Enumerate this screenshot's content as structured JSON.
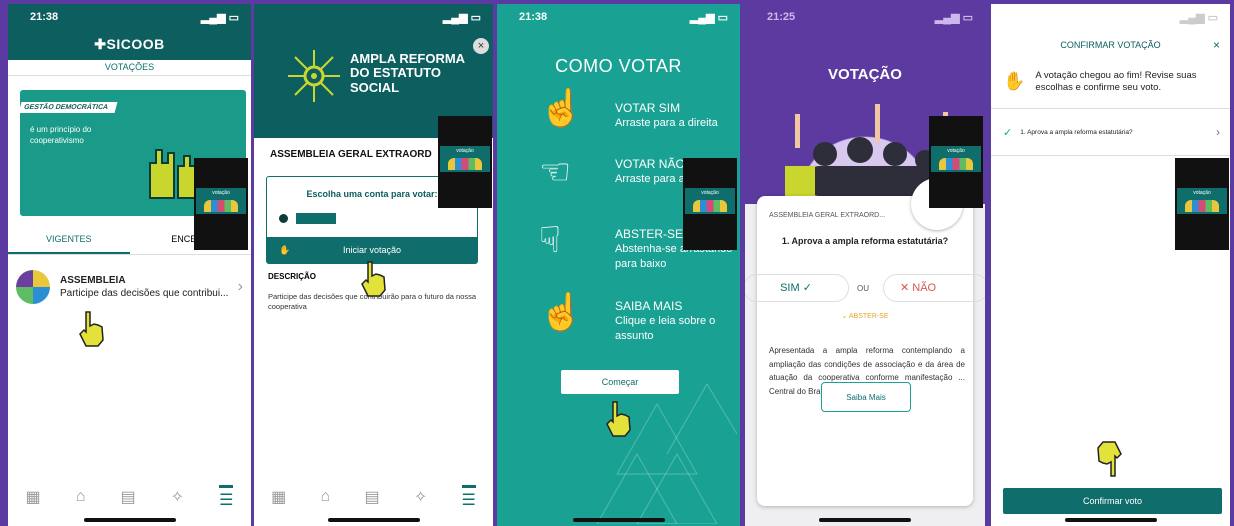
{
  "p1": {
    "time": "21:38",
    "brand": "SICOOB",
    "section": "VOTAÇÕES",
    "card_badge": "GESTÃO DEMOCRÁTICA",
    "card_text": "é um princípio do cooperativismo",
    "tabs": [
      "VIGENTES",
      "ENCERR"
    ],
    "item_title": "ASSEMBLEIA",
    "item_sub": "Participe das decisões que contribui..."
  },
  "p2": {
    "title": "AMPLA REFORMA DO ESTATUTO SOCIAL",
    "close": "×",
    "assembly": "ASSEMBLEIA GERAL EXTRAORD",
    "choose": "Escolha uma conta para votar:",
    "start": "Iniciar votação",
    "desc_label": "DESCRIÇÃO",
    "desc_text": "Participe das decisões que contribuirão para o futuro da nossa cooperativa"
  },
  "p3": {
    "time": "21:38",
    "title": "COMO VOTAR",
    "rows": [
      {
        "title": "VOTAR SIM",
        "text": "Arraste para a direita",
        "icon": "swipe-right-icon",
        "glyph": "☝"
      },
      {
        "title": "VOTAR NÃO",
        "text": "Arraste para a esquerda",
        "icon": "swipe-left-icon",
        "glyph": "☜"
      },
      {
        "title": "ABSTER-SE",
        "text": "Abstenha-se arrastando para baixo",
        "icon": "swipe-down-icon",
        "glyph": "☟"
      },
      {
        "title": "SAIBA MAIS",
        "text": "Clique e leia sobre o assunto",
        "icon": "tap-icon",
        "glyph": "☝"
      }
    ],
    "start": "Começar"
  },
  "p4": {
    "time": "21:25",
    "title": "VOTAÇÃO",
    "assembly": "ASSEMBLEIA GERAL EXTRAORD...",
    "question": "1. Aprova a ampla reforma estatutária?",
    "yes": "SIM",
    "or": "OU",
    "no": "NÃO",
    "abstain": "ABSTER-SE",
    "description": "Apresentada a ampla reforma contemplando a ampliação das condições de associação e da área de atuação da cooperativa conforme manifestação ... Central do Brasil. Com ... estatuto, a",
    "more": "Saiba Mais"
  },
  "p5": {
    "header": "CONFIRMAR VOTAÇÃO",
    "close": "×",
    "message": "A votação chegou ao fim! Revise suas escolhas e confirme seu voto.",
    "question": "1. Aprova a ampla reforma estatutária?",
    "confirm": "Confirmar voto"
  },
  "thumb_label": "votação",
  "colors": {
    "teal": "#0f6e6c",
    "purple": "#5c3a9f",
    "green": "#19a293"
  }
}
